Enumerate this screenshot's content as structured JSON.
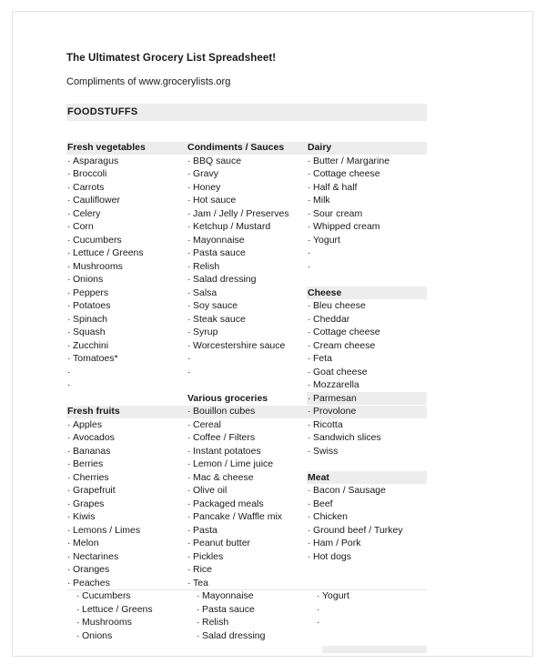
{
  "document": {
    "title": "The Ultimatest Grocery List Spreadsheet!",
    "subtitle": "Compliments of www.grocerylists.org",
    "banner": "FOODSTUFFS",
    "bullet": "·"
  },
  "columns": [
    {
      "name": "column-left",
      "sections": [
        {
          "header": "Fresh vegetables",
          "items": [
            "Asparagus",
            "Broccoli",
            "Carrots",
            "Cauliflower",
            "Celery",
            "Corn",
            "Cucumbers",
            "Lettuce / Greens",
            "Mushrooms",
            "Onions",
            "Peppers",
            "Potatoes",
            "Spinach",
            "Squash",
            "Zucchini",
            "Tomatoes*",
            "",
            ""
          ]
        },
        {
          "header": "Fresh fruits",
          "items": [
            "Apples",
            "Avocados",
            "Bananas",
            "Berries",
            "Cherries",
            "Grapefruit",
            "Grapes",
            "Kiwis",
            "Lemons / Limes",
            "Melon",
            "Nectarines",
            "Oranges",
            "Peaches"
          ]
        }
      ],
      "overflow": [
        "Cucumbers",
        "Lettuce / Greens",
        "Mushrooms",
        "Onions"
      ]
    },
    {
      "name": "column-middle",
      "sections": [
        {
          "header": "Condiments / Sauces",
          "items": [
            "BBQ sauce",
            "Gravy",
            "Honey",
            "Hot sauce",
            "Jam / Jelly / Preserves",
            "Ketchup / Mustard",
            "Mayonnaise",
            "Pasta sauce",
            "Relish",
            "Salad dressing",
            "Salsa",
            "Soy sauce",
            "Steak sauce",
            "Syrup",
            "Worcestershire sauce",
            "",
            ""
          ]
        },
        {
          "header": "Various groceries",
          "items": [
            "Bouillon cubes",
            "Cereal",
            "Coffee / Filters",
            "Instant potatoes",
            "Lemon / Lime juice",
            "Mac & cheese",
            "Olive oil",
            "Packaged meals",
            "Pancake / Waffle mix",
            "Pasta",
            "Peanut butter",
            "Pickles",
            "Rice",
            "Tea"
          ]
        }
      ],
      "overflow": [
        "Mayonnaise",
        "Pasta sauce",
        "Relish",
        "Salad dressing"
      ]
    },
    {
      "name": "column-right",
      "sections": [
        {
          "header": "Dairy",
          "items": [
            "Butter / Margarine",
            "Cottage cheese",
            "Half & half",
            "Milk",
            "Sour cream",
            "Whipped cream",
            "Yogurt",
            "",
            ""
          ]
        },
        {
          "header": "Cheese",
          "items": [
            "Bleu cheese",
            "Cheddar",
            "Cottage cheese",
            "Cream cheese",
            "Feta",
            "Goat cheese",
            "Mozzarella",
            "Parmesan",
            "Provolone",
            "Ricotta",
            "Sandwich slices",
            "Swiss"
          ]
        },
        {
          "header": "Meat",
          "items": [
            "Bacon / Sausage",
            "Beef",
            "Chicken",
            "Ground beef / Turkey",
            "Ham / Pork",
            "Hot dogs"
          ]
        }
      ],
      "overflow": [
        "Yogurt",
        "",
        ""
      ]
    }
  ]
}
